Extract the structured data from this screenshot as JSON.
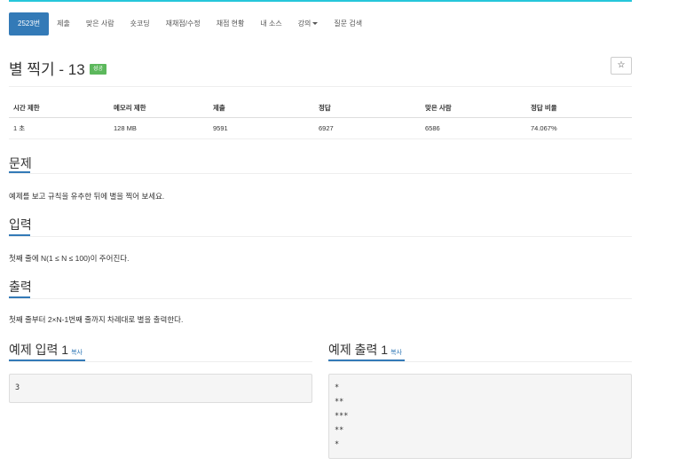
{
  "nav": {
    "tabs": [
      {
        "label": "2523번",
        "active": true
      },
      {
        "label": "제출"
      },
      {
        "label": "맞은 사람"
      },
      {
        "label": "숏코딩"
      },
      {
        "label": "재채점/수정"
      },
      {
        "label": "채점 현황"
      },
      {
        "label": "내 소스"
      },
      {
        "label": "강의"
      },
      {
        "label": "질문 검색"
      }
    ]
  },
  "problem": {
    "title": "별 찍기 - 13",
    "badge": "성공",
    "star_icon": "☆"
  },
  "info_table": {
    "headers": [
      "시간 제한",
      "메모리 제한",
      "제출",
      "정답",
      "맞은 사람",
      "정답 비율"
    ],
    "values": [
      "1 초",
      "128 MB",
      "9591",
      "6927",
      "6586",
      "74.067%"
    ]
  },
  "sections": {
    "problem_title": "문제",
    "problem_text": "예제를 보고 규칙을 유추한 뒤에 별을 찍어 보세요.",
    "input_title": "입력",
    "input_text": "첫째 줄에 N(1 ≤ N ≤ 100)이 주어진다.",
    "output_title": "출력",
    "output_text": "첫째 줄부터 2×N-1번째 줄까지 차례대로 별을 출력한다."
  },
  "samples": {
    "input_title": "예제 입력 1",
    "output_title": "예제 출력 1",
    "copy_label": "복사",
    "input_value": "3",
    "output_value": "*\n**\n***\n**\n*"
  },
  "colors": {
    "accent": "#337ab7",
    "top_line": "#26c6da",
    "success": "#5cb85c"
  }
}
